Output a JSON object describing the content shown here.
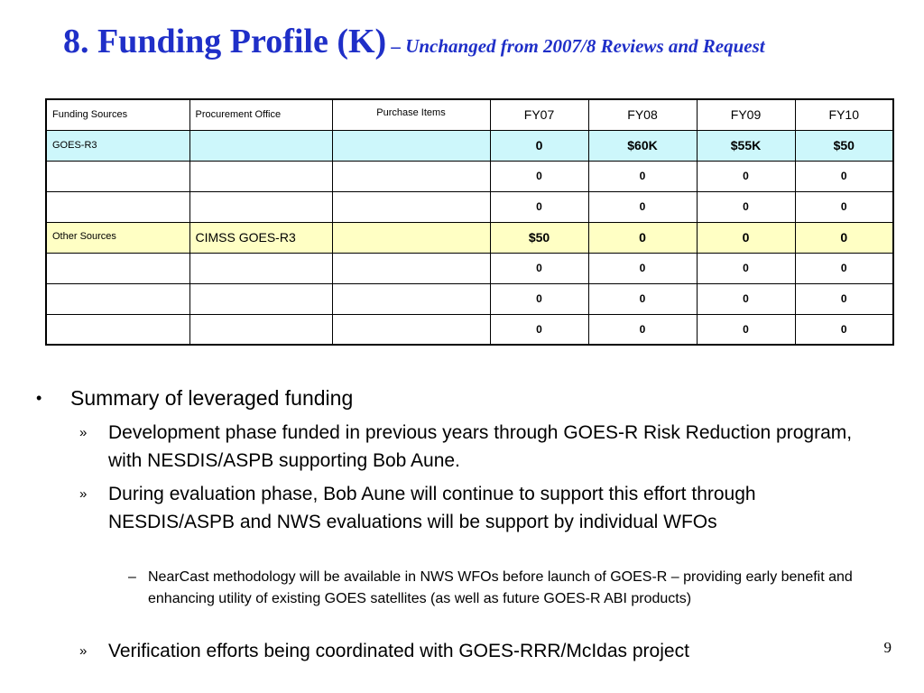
{
  "title": {
    "main": "8. Funding Profile (K)",
    "subtitle": " – Unchanged from 2007/8 Reviews and Request"
  },
  "table": {
    "headers": {
      "funding_sources": "Funding Sources",
      "procurement_office": "Procurement Office",
      "purchase_items": "Purchase Items",
      "fy07": "FY07",
      "fy08": "FY08",
      "fy09": "FY09",
      "fy10": "FY10"
    },
    "rows": [
      {
        "source": "GOES-R3",
        "office": "",
        "items": "",
        "fy07": "0",
        "fy08": "$60K",
        "fy09": "$55K",
        "fy10": "$50"
      },
      {
        "source": "",
        "office": "",
        "items": "",
        "fy07": "0",
        "fy08": "0",
        "fy09": "0",
        "fy10": "0"
      },
      {
        "source": "",
        "office": "",
        "items": "",
        "fy07": "0",
        "fy08": "0",
        "fy09": "0",
        "fy10": "0"
      },
      {
        "source": "Other Sources",
        "office": "CIMSS GOES-R3",
        "items": "",
        "fy07": "$50",
        "fy08": "0",
        "fy09": "0",
        "fy10": "0"
      },
      {
        "source": "",
        "office": "",
        "items": "",
        "fy07": "0",
        "fy08": "0",
        "fy09": "0",
        "fy10": "0"
      },
      {
        "source": "",
        "office": "",
        "items": "",
        "fy07": "0",
        "fy08": "0",
        "fy09": "0",
        "fy10": "0"
      },
      {
        "source": "",
        "office": "",
        "items": "",
        "fy07": "0",
        "fy08": "0",
        "fy09": "0",
        "fy10": "0"
      }
    ]
  },
  "bullets": {
    "level1_mark": "•",
    "level2_mark": "»",
    "level3_mark": "–",
    "summary": "Summary of leveraged funding",
    "development": "Development phase funded in previous years through GOES-R Risk Reduction program, with NESDIS/ASPB supporting Bob Aune.",
    "evaluation": "During evaluation phase, Bob Aune will continue to support this effort through NESDIS/ASPB and NWS evaluations will be support by individual WFOs",
    "nearcast": "NearCast methodology will be available in NWS WFOs before launch of GOES-R – providing early benefit and enhancing utility of existing GOES satellites (as well as future GOES-R ABI products)",
    "verification": "Verification efforts being coordinated with GOES-RRR/McIdas project"
  },
  "page_number": "9",
  "colors": {
    "title": "#1f2fc8",
    "goes_row": "#cdf7fb",
    "other_row": "#ffffc4"
  }
}
